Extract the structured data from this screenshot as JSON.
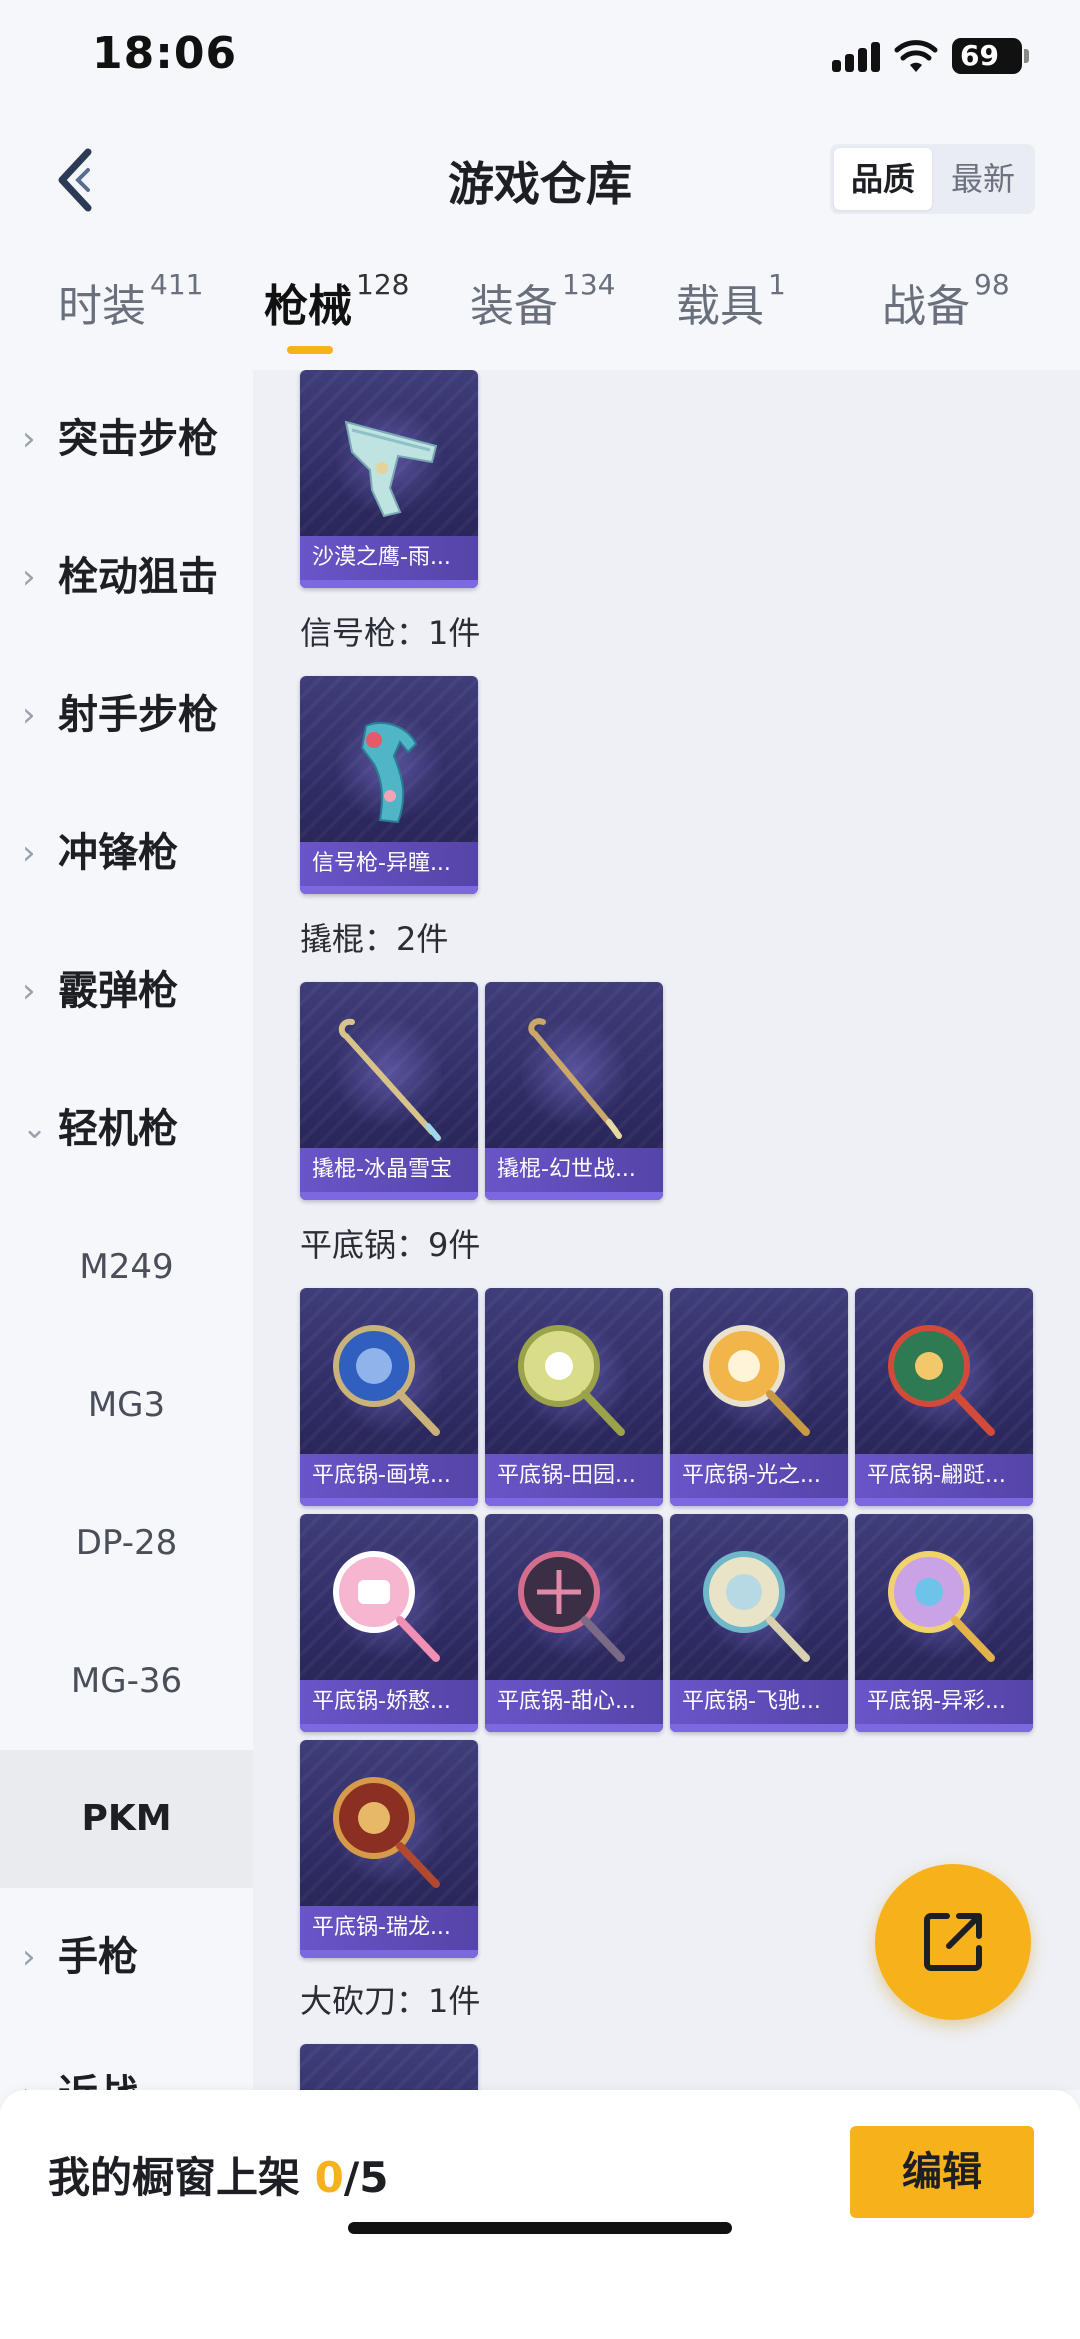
{
  "status_bar": {
    "time": "18:06",
    "battery": "69"
  },
  "header": {
    "title": "游戏仓库",
    "sort_options": [
      "品质",
      "最新"
    ]
  },
  "tabs": [
    {
      "label": "时装",
      "count": "411"
    },
    {
      "label": "枪械",
      "count": "128"
    },
    {
      "label": "装备",
      "count": "134"
    },
    {
      "label": "载具",
      "count": "1"
    },
    {
      "label": "战备",
      "count": "98"
    }
  ],
  "sidebar": {
    "items": [
      "突击步枪",
      "栓动狙击",
      "射手步枪",
      "冲锋枪",
      "霰弹枪",
      "轻机枪"
    ],
    "sub_items": [
      "M249",
      "MG3",
      "DP-28",
      "MG-36",
      "PKM"
    ],
    "items_after": [
      "手枪",
      "近战"
    ]
  },
  "sections": [
    {
      "title": "",
      "cards": [
        "沙漠之鹰-雨..."
      ]
    },
    {
      "title": "信号枪：1件",
      "cards": [
        "信号枪-异瞳..."
      ]
    },
    {
      "title": "撬棍：2件",
      "cards": [
        "撬棍-冰晶雪宝",
        "撬棍-幻世战..."
      ]
    },
    {
      "title": "平底锅：9件",
      "cards": [
        "平底锅-画境...",
        "平底锅-田园...",
        "平底锅-光之...",
        "平底锅-翩跹...",
        "平底锅-娇憨...",
        "平底锅-甜心...",
        "平底锅-飞驰...",
        "平底锅-异彩...",
        "平底锅-瑞龙..."
      ]
    },
    {
      "title": "大砍刀：1件",
      "cards": []
    }
  ],
  "bottom_bar": {
    "showcase_label": "我的橱窗上架 ",
    "current": "0",
    "total": "/5",
    "edit_label": "编辑"
  },
  "colors": {
    "accent": "#f7b21b",
    "card_top": "#3f3d7a",
    "card_label": "#6a55c8"
  }
}
